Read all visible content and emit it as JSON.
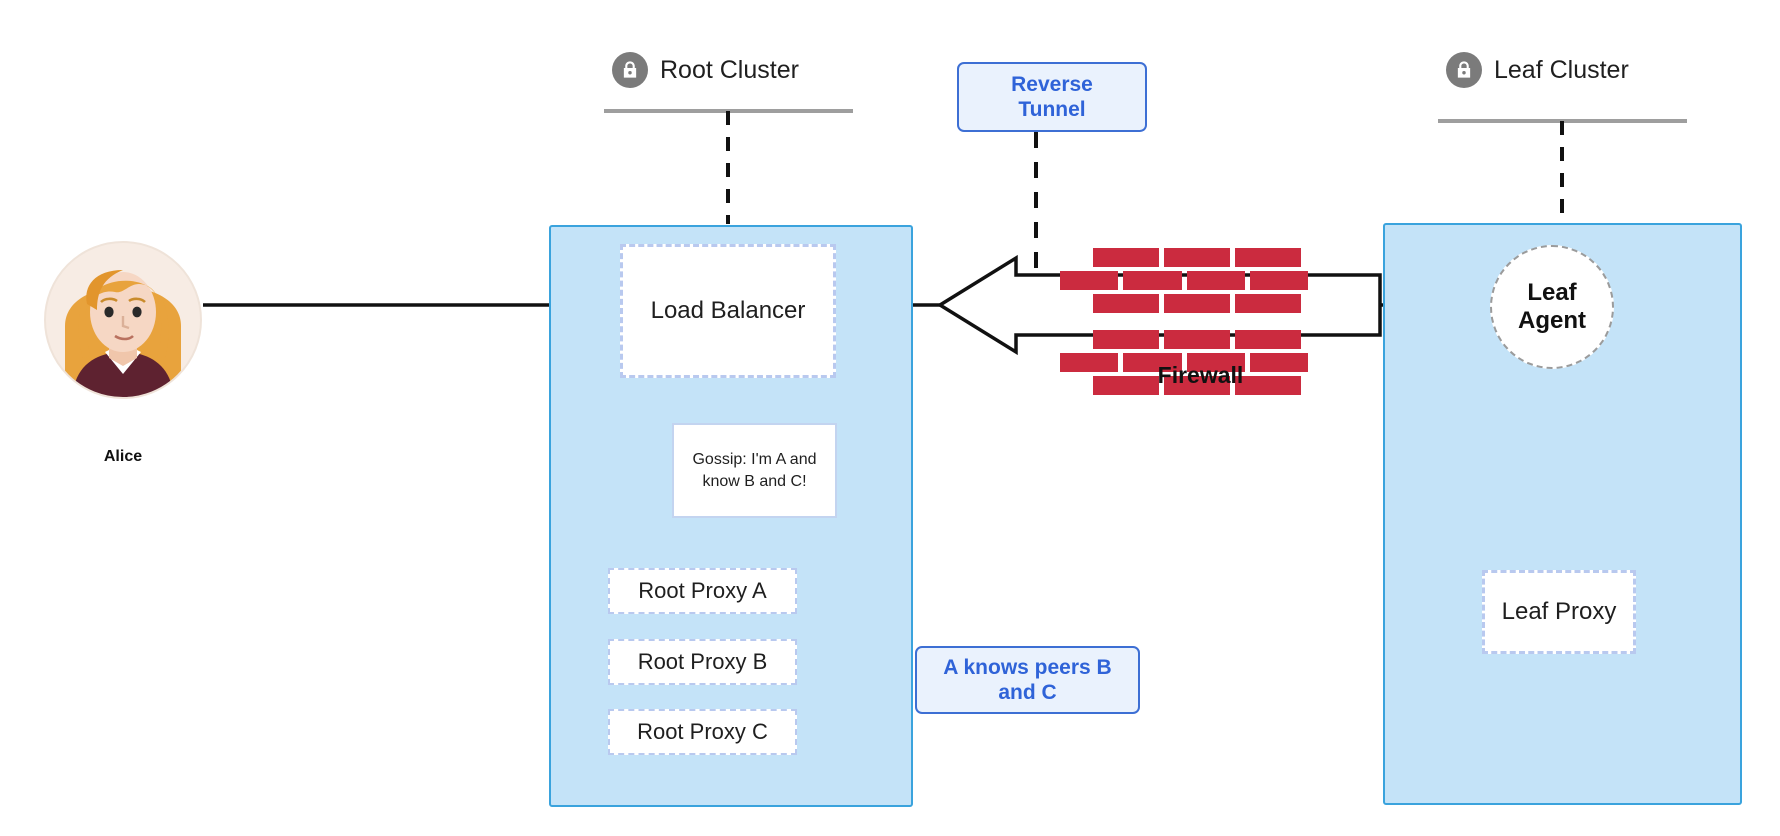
{
  "diagram": {
    "title": "Teleport Root and Leaf Cluster Reverse Tunnel Architecture",
    "colors": {
      "cluster_fill": "#c4e3f8",
      "cluster_border": "#3aa3dd",
      "node_border": "#b9c9ef",
      "callout_text": "#2f63d8",
      "callout_border": "#3d6fd4",
      "callout_fill": "#eaf2fd",
      "brick": "#cb2b3f",
      "lock_badge": "#7b7b7b",
      "connector": "#111111"
    }
  },
  "user": {
    "name": "Alice",
    "avatar_icon": "user-avatar-icon",
    "avatar_colors": {
      "background": "#f7ece4",
      "hair": "#e8a33d",
      "skin": "#f6d7c4",
      "shirt": "#5e2230",
      "collar": "#ffffff"
    }
  },
  "root_cluster": {
    "label": "Root Cluster",
    "lock_icon": "lock-icon",
    "load_balancer": {
      "label": "Load Balancer"
    },
    "gossip_note": {
      "line1": "Gossip: I'm A and",
      "line2": "know B and C!"
    },
    "proxies": [
      {
        "label": "Root Proxy A"
      },
      {
        "label": "Root Proxy B"
      },
      {
        "label": "Root Proxy C"
      }
    ],
    "peers_callout": {
      "line1": "A knows peers B",
      "line2": "and C"
    }
  },
  "leaf_cluster": {
    "label": "Leaf Cluster",
    "lock_icon": "lock-icon",
    "agent": {
      "line1": "Leaf",
      "line2": "Agent"
    },
    "proxy": {
      "label": "Leaf Proxy"
    }
  },
  "network": {
    "reverse_tunnel": {
      "line1": "Reverse",
      "line2": "Tunnel"
    },
    "firewall": {
      "label": "Firewall",
      "icon": "brick-wall-icon"
    }
  }
}
